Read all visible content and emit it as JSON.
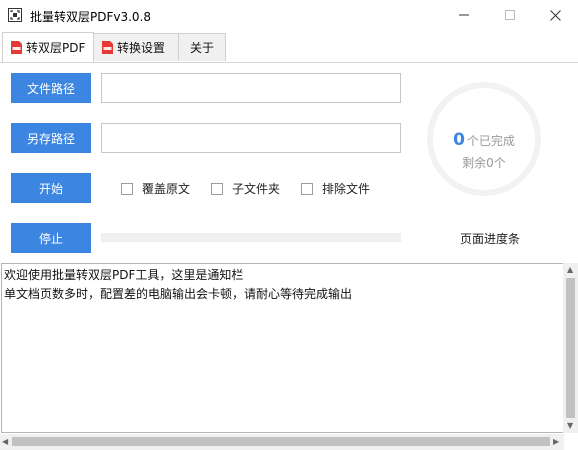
{
  "window": {
    "title": "批量转双层PDFv3.0.8",
    "minimize_glyph": "—",
    "maximize_glyph": "☐",
    "close_glyph": "✕"
  },
  "tabs": [
    {
      "label": "转双层PDF",
      "icon": "pdf-file-icon",
      "active": true
    },
    {
      "label": "转换设置",
      "icon": "pdf-file-icon",
      "active": false
    },
    {
      "label": "关于",
      "icon": null,
      "active": false
    }
  ],
  "form": {
    "file_path_button": "文件路径",
    "file_path_value": "",
    "save_path_button": "另存路径",
    "save_path_value": "",
    "start_button": "开始",
    "stop_button": "停止",
    "options": [
      {
        "label": "覆盖原文",
        "checked": false
      },
      {
        "label": "子文件夹",
        "checked": false
      },
      {
        "label": "排除文件",
        "checked": false
      }
    ],
    "page_progress_fraction": 0
  },
  "status": {
    "completed_count": "0",
    "completed_label": "个已完成",
    "remaining_text": "剩余0个",
    "page_progress_label": "页面进度条"
  },
  "log": {
    "lines": [
      "欢迎使用批量转双层PDF工具，这里是通知栏",
      "单文档页数多时，配置差的电脑输出会卡顿，请耐心等待完成输出"
    ]
  },
  "colors": {
    "accent": "#3c86e2",
    "ring": "#f2f2f2",
    "muted_text": "#9a9a9a"
  }
}
